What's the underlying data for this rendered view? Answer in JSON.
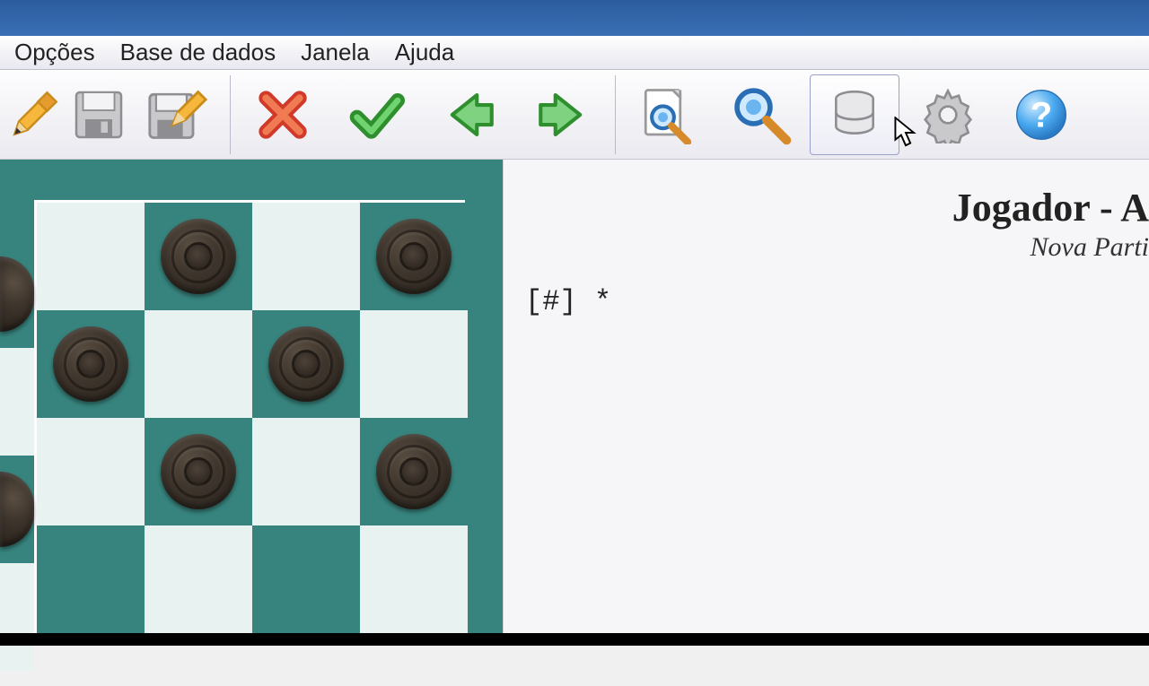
{
  "menu": {
    "options": "Opções",
    "database": "Base de dados",
    "window": "Janela",
    "help": "Ajuda"
  },
  "toolbar": {
    "icons": {
      "new": "pencil-icon",
      "save": "floppy-icon",
      "save_edit": "floppy-pencil-icon",
      "cancel": "red-x-icon",
      "accept": "green-check-icon",
      "back": "arrow-left-icon",
      "forward": "arrow-right-icon",
      "search_doc": "search-page-icon",
      "search": "magnifier-icon",
      "database": "database-icon",
      "settings": "gear-icon",
      "help": "help-icon"
    }
  },
  "header": {
    "player_line": "Jogador - A",
    "subtitle": "Nova Parti"
  },
  "notation": {
    "line1": "[#] *"
  },
  "board": {
    "rows_visible": 4,
    "cols_visible": 4,
    "dark_color": "#37837d",
    "light_color": "#e8f3f1",
    "piece_positions_dark": [
      [
        0,
        1
      ],
      [
        0,
        3
      ],
      [
        1,
        0
      ],
      [
        1,
        2
      ],
      [
        2,
        1
      ],
      [
        2,
        3
      ]
    ],
    "left_partial_pieces": [
      0,
      2
    ]
  }
}
